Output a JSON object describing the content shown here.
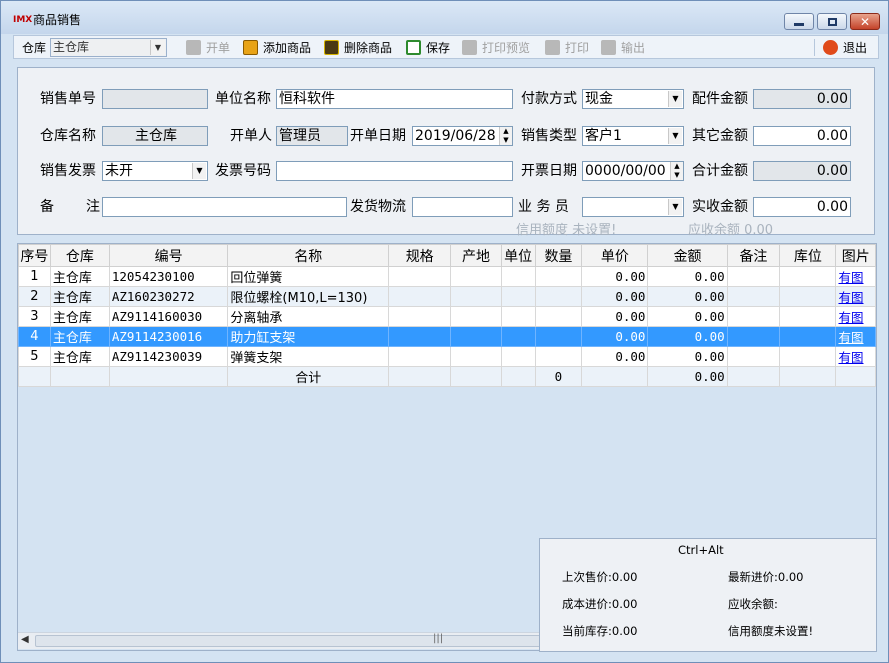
{
  "window": {
    "logo": "IMX",
    "title": "商品销售"
  },
  "toolbar": {
    "warehouse_label": "仓库",
    "warehouse_value": "主仓库",
    "open_label": "开单",
    "add_label": "添加商品",
    "delete_label": "删除商品",
    "save_label": "保存",
    "print_preview_label": "打印预览",
    "print_label": "打印",
    "export_label": "输出",
    "exit_label": "退出"
  },
  "form": {
    "sale_no_label": "销售单号",
    "sale_no": "",
    "unit_name_label": "单位名称",
    "unit_name": "恒科软件",
    "payment_label": "付款方式",
    "payment": "现金",
    "parts_amount_label": "配件金额",
    "parts_amount": "0.00",
    "warehouse_name_label": "仓库名称",
    "warehouse_name": "主仓库",
    "creator_label": "开单人",
    "creator": "管理员",
    "date_label": "开单日期",
    "date": "2019/06/28",
    "sale_type_label": "销售类型",
    "sale_type": "客户1",
    "other_amount_label": "其它金额",
    "other_amount": "0.00",
    "invoice_label": "销售发票",
    "invoice": "未开",
    "invoice_no_label": "发票号码",
    "invoice_no": "",
    "invoice_date_label": "开票日期",
    "invoice_date": "0000/00/00",
    "total_amount_label": "合计金额",
    "total_amount": "0.00",
    "remark_label_a": "备",
    "remark_label_b": "注",
    "remark": "",
    "logistics_label": "发货物流",
    "logistics": "",
    "salesman_label": "业 务 员",
    "salesman": "",
    "received_label": "实收金额",
    "received": "0.00",
    "credit_hint": "信用额度 未设置!",
    "receivable_hint": "应收余额 0.00"
  },
  "grid": {
    "headers": [
      "序号",
      "仓库",
      "编号",
      "名称",
      "规格",
      "产地",
      "单位",
      "数量",
      "单价",
      "金额",
      "备注",
      "库位",
      "图片"
    ],
    "rows": [
      {
        "seq": "1",
        "wh": "主仓库",
        "code": "12054230100",
        "name": "回位弹簧",
        "qty": "",
        "price": "0.00",
        "amount": "0.00",
        "img": "有图"
      },
      {
        "seq": "2",
        "wh": "主仓库",
        "code": "AZ160230272",
        "name": "限位螺栓(M10,L=130)",
        "qty": "",
        "price": "0.00",
        "amount": "0.00",
        "img": "有图"
      },
      {
        "seq": "3",
        "wh": "主仓库",
        "code": "AZ9114160030",
        "name": "分离轴承",
        "qty": "",
        "price": "0.00",
        "amount": "0.00",
        "img": "有图"
      },
      {
        "seq": "4",
        "wh": "主仓库",
        "code": "AZ9114230016",
        "name": "助力缸支架",
        "qty": "",
        "price": "0.00",
        "amount": "0.00",
        "img": "有图"
      },
      {
        "seq": "5",
        "wh": "主仓库",
        "code": "AZ9114230039",
        "name": "弹簧支架",
        "qty": "",
        "price": "0.00",
        "amount": "0.00",
        "img": "有图"
      }
    ],
    "selected_row": 4,
    "sum_label": "合计",
    "sum_qty": "0",
    "sum_amount": "0.00"
  },
  "info": {
    "shortcut": "Ctrl+Alt",
    "last_price": "上次售价:0.00",
    "latest_cost": "最新进价:0.00",
    "cost_price": "成本进价:0.00",
    "receivable": "应收余额:",
    "stock": "当前库存:0.00",
    "credit": "信用额度未设置!"
  },
  "colors": {
    "selected_row": "#3399ff",
    "link": "#0000ee",
    "window_bg": "#d4e3f2"
  }
}
